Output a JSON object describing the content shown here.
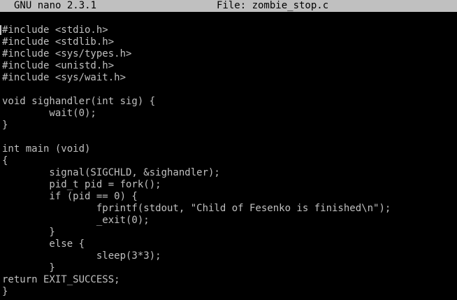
{
  "titlebar": {
    "app_version": "GNU nano 2.3.1",
    "file_label": "File: zombie_stop.c"
  },
  "editor": {
    "lines": [
      "#include <stdio.h>",
      "#include <stdlib.h>",
      "#include <sys/types.h>",
      "#include <unistd.h>",
      "#include <sys/wait.h>",
      "",
      "void sighandler(int sig) {",
      "        wait(0);",
      "}",
      "",
      "int main (void)",
      "{",
      "        signal(SIGCHLD, &sighandler);",
      "        pid_t pid = fork();",
      "        if (pid == 0) {",
      "                fprintf(stdout, \"Child of Fesenko is finished\\n\");",
      "                _exit(0);",
      "        }",
      "        else {",
      "                sleep(3*3);",
      "        }",
      "return EXIT_SUCCESS;",
      "}"
    ]
  },
  "colors": {
    "background": "#000000",
    "text": "#c0c0c0",
    "titlebar_bg": "#c0c0c0",
    "titlebar_text": "#000000"
  }
}
